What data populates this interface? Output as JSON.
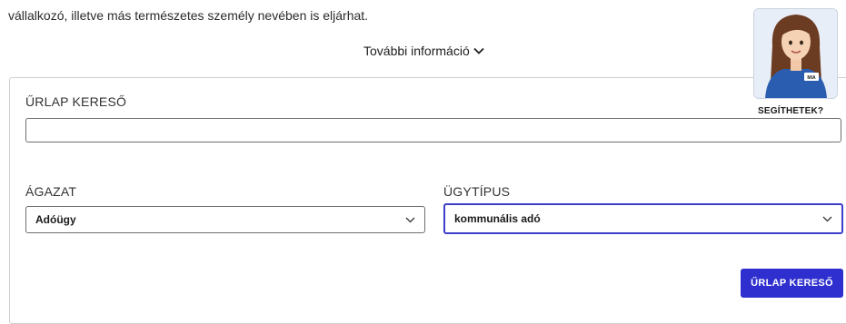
{
  "intro_text": "vállalkozó, illetve más természetes személy nevében is eljárhat.",
  "more_info": {
    "label": "További információ",
    "icon": "chevron-down-icon"
  },
  "assistant": {
    "caption": "SEGÍTHETEK?",
    "badge": "MIA"
  },
  "form": {
    "search_label": "ŰRLAP KERESŐ",
    "search_value": "",
    "agazat_label": "ÁGAZAT",
    "agazat_value": "Adóügy",
    "ugytipus_label": "ÜGYTÍPUS",
    "ugytipus_value": "kommunális adó",
    "submit_label": "ŰRLAP KERESŐ"
  },
  "colors": {
    "accent": "#2f2fcf",
    "focused_border": "#3d3ec9",
    "panel_border": "#cfcfcf"
  }
}
